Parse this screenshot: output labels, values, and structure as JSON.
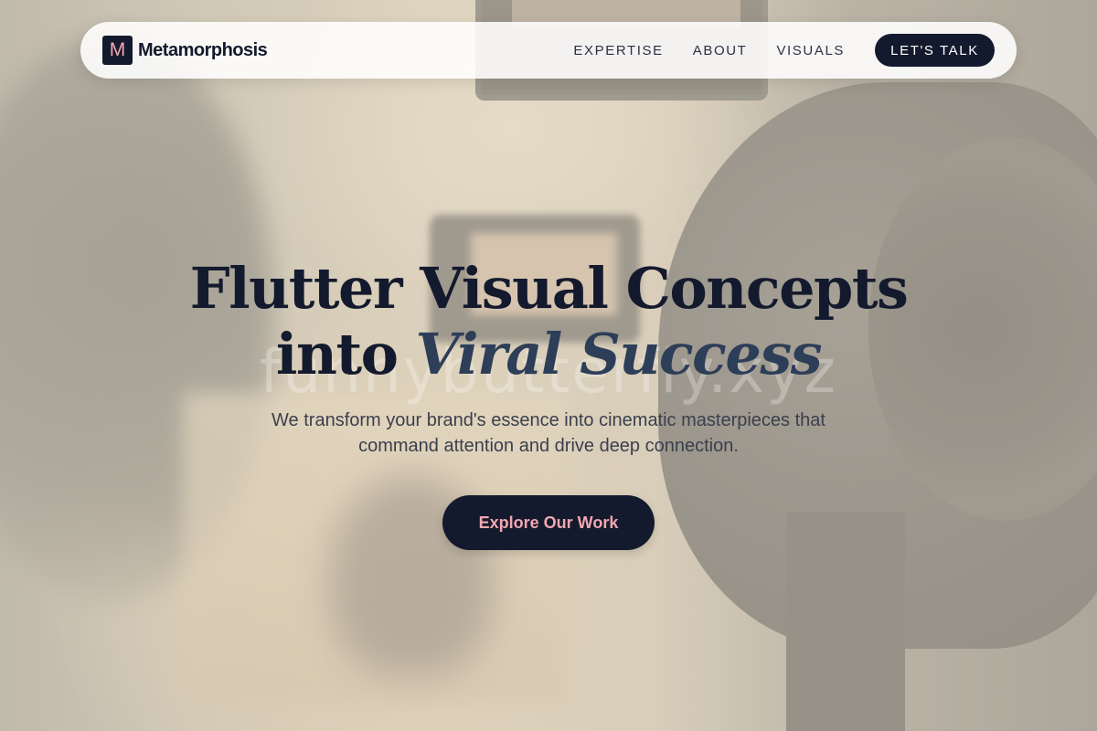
{
  "brand": {
    "logo_letter": "M",
    "name": "Metamorphosis"
  },
  "nav": {
    "links": [
      "EXPERTISE",
      "ABOUT",
      "VISUALS"
    ],
    "cta_label": "LET'S TALK"
  },
  "hero": {
    "title_line1": "Flutter Visual Concepts",
    "title_line2_plain": "into ",
    "title_line2_accent": "Viral Success",
    "subtitle": "We transform your brand's essence into cinematic masterpieces that command attention and drive deep connection.",
    "button_label": "Explore Our Work"
  },
  "watermark": "funnybutterfly.xyz",
  "colors": {
    "navy": "#141a2d",
    "accent_pink": "#f2a7b1",
    "accent_italic": "#2d3e58"
  }
}
